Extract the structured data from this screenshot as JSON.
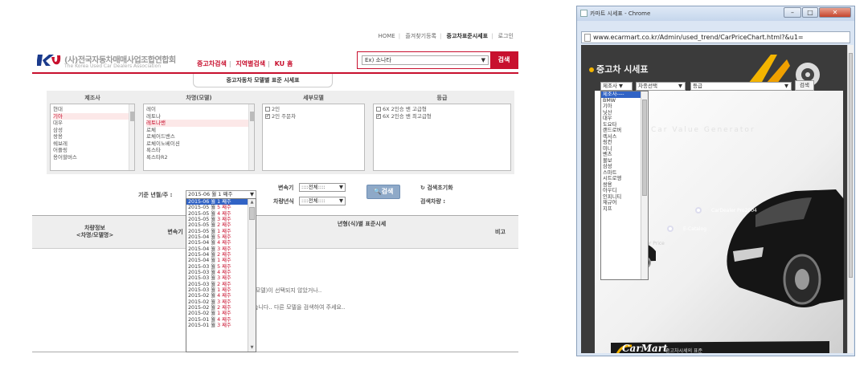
{
  "left_page": {
    "top_links": [
      "HOME",
      "즐겨찾기등록",
      "중고차표준시세표",
      "로그인"
    ],
    "org_name": "(사)전국자동차매매사업조합연합회",
    "org_sub": "The Korea Used Car Dealers Association",
    "main_nav": [
      "중고차검색",
      "지역별검색",
      "KU 홈"
    ],
    "search_select_value": "Ex) 소나타",
    "search_button": "검색",
    "center_tab": "중고자동차 모델별 표준 시세표",
    "filter_headers": [
      "제조사",
      "차명(모델)",
      "세부모델",
      "등급"
    ],
    "makers": [
      "현대",
      "기아",
      "대우",
      "삼성",
      "쌍용",
      "쉐보레",
      "어플링",
      "용어할버스"
    ],
    "models": [
      "레이",
      "레토나",
      "레토나밴",
      "로체",
      "로체어드밴스",
      "로체이노베이션",
      "록스타",
      "록스타R2"
    ],
    "detail_models": [
      "2인",
      "2인 주문차"
    ],
    "grades": [
      "6X 2인승 밴 고급형",
      "6X 2인승 밴 최고급형"
    ],
    "criteria_label": "기준 년월/주 :",
    "criteria_value": "2015-06 월 1 째주",
    "transmission_label": "변속기",
    "transmission_value": "::::전체::::",
    "fuel_label": "차량년식",
    "fuel_value": "::::전체::::",
    "search_btn2": "검색",
    "reset_label": "검색초기화",
    "result_label": "검색차량 :",
    "table_headers": [
      "차량정보\n<차명/모델명>",
      "변속기",
      "년형(식)별 표준시세",
      "비고"
    ],
    "message1": "(모델)이 선택되지 않았거나..",
    "message2": "습니다.. 다른 모델을 검색하여 주세요..",
    "week_options": [
      {
        "ym": "2015-06 월",
        "w": "1 째주"
      },
      {
        "ym": "2015-05 월",
        "w": "5 째주"
      },
      {
        "ym": "2015-05 월",
        "w": "4 째주"
      },
      {
        "ym": "2015-05 월",
        "w": "3 째주"
      },
      {
        "ym": "2015-05 월",
        "w": "2 째주"
      },
      {
        "ym": "2015-05 월",
        "w": "1 째주"
      },
      {
        "ym": "2015-04 월",
        "w": "5 째주"
      },
      {
        "ym": "2015-04 월",
        "w": "4 째주"
      },
      {
        "ym": "2015-04 월",
        "w": "3 째주"
      },
      {
        "ym": "2015-04 월",
        "w": "2 째주"
      },
      {
        "ym": "2015-04 월",
        "w": "1 째주"
      },
      {
        "ym": "2015-03 월",
        "w": "5 째주"
      },
      {
        "ym": "2015-03 월",
        "w": "4 째주"
      },
      {
        "ym": "2015-03 월",
        "w": "3 째주"
      },
      {
        "ym": "2015-03 월",
        "w": "2 째주"
      },
      {
        "ym": "2015-03 월",
        "w": "1 째주"
      },
      {
        "ym": "2015-02 월",
        "w": "4 째주"
      },
      {
        "ym": "2015-02 월",
        "w": "3 째주"
      },
      {
        "ym": "2015-02 월",
        "w": "2 째주"
      },
      {
        "ym": "2015-02 월",
        "w": "1 째주"
      },
      {
        "ym": "2015-01 월",
        "w": "4 째주"
      },
      {
        "ym": "2015-01 월",
        "w": "3 째주"
      }
    ]
  },
  "window": {
    "title": "카마트 시세표 - Chrome",
    "url": "www.ecarmart.co.kr/Admin/used_trend/CarPriceChart.html?&u1=",
    "page_title": "중고차 시세표",
    "maker_select": "제조사",
    "model_select": "차종선택",
    "grade_select": "등급",
    "search_btn": "검색",
    "makers": [
      "제조사----",
      "BMW",
      "기아",
      "닛산",
      "대우",
      "도요타",
      "랜드로버",
      "렉서스",
      "링컨",
      "미니",
      "벤츠",
      "볼보",
      "삼성",
      "스마트",
      "시트로엥",
      "쌍용",
      "아우디",
      "인피니티",
      "재규어",
      "지프"
    ],
    "faint_text": "Car Value Generator",
    "label_dealer": "CarDealer Pro2004",
    "label_catalog": "E-Catalog",
    "label_price": "Car Price",
    "brand_text": "CarMart",
    "brand_tag": "중고차시세의 표준"
  }
}
